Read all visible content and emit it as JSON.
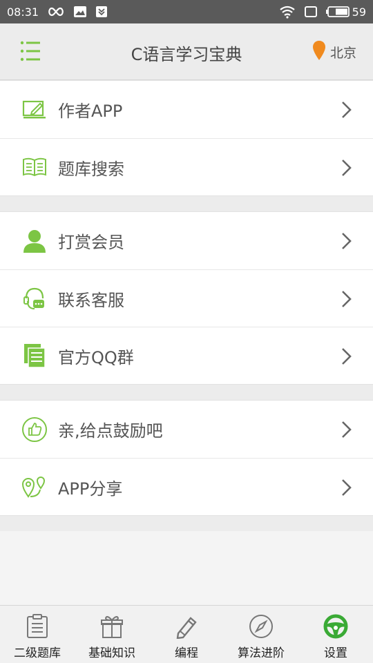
{
  "status_bar": {
    "time": "08:31",
    "battery": "59"
  },
  "header": {
    "title": "C语言学习宝典",
    "location": "北京"
  },
  "menu_groups": [
    {
      "items": [
        {
          "label": "作者APP",
          "icon": "edit-box-icon"
        },
        {
          "label": "题库搜索",
          "icon": "open-book-icon"
        }
      ]
    },
    {
      "items": [
        {
          "label": "打赏会员",
          "icon": "user-icon"
        },
        {
          "label": "联系客服",
          "icon": "customer-service-icon"
        },
        {
          "label": "官方QQ群",
          "icon": "documents-icon"
        }
      ]
    },
    {
      "items": [
        {
          "label": "亲,给点鼓励吧",
          "icon": "thumbs-up-icon"
        },
        {
          "label": "APP分享",
          "icon": "share-location-icon"
        }
      ]
    }
  ],
  "tabs": [
    {
      "label": "二级题库",
      "icon": "clipboard-icon",
      "active": false
    },
    {
      "label": "基础知识",
      "icon": "gift-icon",
      "active": false
    },
    {
      "label": "编程",
      "icon": "pencil-icon",
      "active": false
    },
    {
      "label": "算法进阶",
      "icon": "compass-icon",
      "active": false
    },
    {
      "label": "设置",
      "icon": "steering-wheel-icon",
      "active": true
    }
  ],
  "colors": {
    "accent": "#7cc544",
    "status_bar": "#5a5a5a",
    "location_pin": "#f08a1e",
    "text": "#555555"
  }
}
